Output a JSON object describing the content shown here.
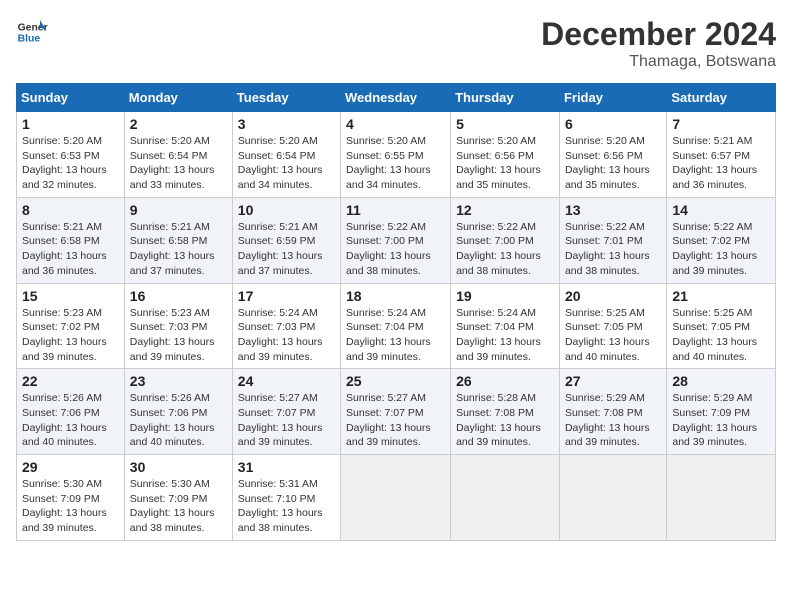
{
  "header": {
    "logo_line1": "General",
    "logo_line2": "Blue",
    "month": "December 2024",
    "location": "Thamaga, Botswana"
  },
  "weekdays": [
    "Sunday",
    "Monday",
    "Tuesday",
    "Wednesday",
    "Thursday",
    "Friday",
    "Saturday"
  ],
  "weeks": [
    [
      {
        "day": "1",
        "info": "Sunrise: 5:20 AM\nSunset: 6:53 PM\nDaylight: 13 hours\nand 32 minutes."
      },
      {
        "day": "2",
        "info": "Sunrise: 5:20 AM\nSunset: 6:54 PM\nDaylight: 13 hours\nand 33 minutes."
      },
      {
        "day": "3",
        "info": "Sunrise: 5:20 AM\nSunset: 6:54 PM\nDaylight: 13 hours\nand 34 minutes."
      },
      {
        "day": "4",
        "info": "Sunrise: 5:20 AM\nSunset: 6:55 PM\nDaylight: 13 hours\nand 34 minutes."
      },
      {
        "day": "5",
        "info": "Sunrise: 5:20 AM\nSunset: 6:56 PM\nDaylight: 13 hours\nand 35 minutes."
      },
      {
        "day": "6",
        "info": "Sunrise: 5:20 AM\nSunset: 6:56 PM\nDaylight: 13 hours\nand 35 minutes."
      },
      {
        "day": "7",
        "info": "Sunrise: 5:21 AM\nSunset: 6:57 PM\nDaylight: 13 hours\nand 36 minutes."
      }
    ],
    [
      {
        "day": "8",
        "info": "Sunrise: 5:21 AM\nSunset: 6:58 PM\nDaylight: 13 hours\nand 36 minutes."
      },
      {
        "day": "9",
        "info": "Sunrise: 5:21 AM\nSunset: 6:58 PM\nDaylight: 13 hours\nand 37 minutes."
      },
      {
        "day": "10",
        "info": "Sunrise: 5:21 AM\nSunset: 6:59 PM\nDaylight: 13 hours\nand 37 minutes."
      },
      {
        "day": "11",
        "info": "Sunrise: 5:22 AM\nSunset: 7:00 PM\nDaylight: 13 hours\nand 38 minutes."
      },
      {
        "day": "12",
        "info": "Sunrise: 5:22 AM\nSunset: 7:00 PM\nDaylight: 13 hours\nand 38 minutes."
      },
      {
        "day": "13",
        "info": "Sunrise: 5:22 AM\nSunset: 7:01 PM\nDaylight: 13 hours\nand 38 minutes."
      },
      {
        "day": "14",
        "info": "Sunrise: 5:22 AM\nSunset: 7:02 PM\nDaylight: 13 hours\nand 39 minutes."
      }
    ],
    [
      {
        "day": "15",
        "info": "Sunrise: 5:23 AM\nSunset: 7:02 PM\nDaylight: 13 hours\nand 39 minutes."
      },
      {
        "day": "16",
        "info": "Sunrise: 5:23 AM\nSunset: 7:03 PM\nDaylight: 13 hours\nand 39 minutes."
      },
      {
        "day": "17",
        "info": "Sunrise: 5:24 AM\nSunset: 7:03 PM\nDaylight: 13 hours\nand 39 minutes."
      },
      {
        "day": "18",
        "info": "Sunrise: 5:24 AM\nSunset: 7:04 PM\nDaylight: 13 hours\nand 39 minutes."
      },
      {
        "day": "19",
        "info": "Sunrise: 5:24 AM\nSunset: 7:04 PM\nDaylight: 13 hours\nand 39 minutes."
      },
      {
        "day": "20",
        "info": "Sunrise: 5:25 AM\nSunset: 7:05 PM\nDaylight: 13 hours\nand 40 minutes."
      },
      {
        "day": "21",
        "info": "Sunrise: 5:25 AM\nSunset: 7:05 PM\nDaylight: 13 hours\nand 40 minutes."
      }
    ],
    [
      {
        "day": "22",
        "info": "Sunrise: 5:26 AM\nSunset: 7:06 PM\nDaylight: 13 hours\nand 40 minutes."
      },
      {
        "day": "23",
        "info": "Sunrise: 5:26 AM\nSunset: 7:06 PM\nDaylight: 13 hours\nand 40 minutes."
      },
      {
        "day": "24",
        "info": "Sunrise: 5:27 AM\nSunset: 7:07 PM\nDaylight: 13 hours\nand 39 minutes."
      },
      {
        "day": "25",
        "info": "Sunrise: 5:27 AM\nSunset: 7:07 PM\nDaylight: 13 hours\nand 39 minutes."
      },
      {
        "day": "26",
        "info": "Sunrise: 5:28 AM\nSunset: 7:08 PM\nDaylight: 13 hours\nand 39 minutes."
      },
      {
        "day": "27",
        "info": "Sunrise: 5:29 AM\nSunset: 7:08 PM\nDaylight: 13 hours\nand 39 minutes."
      },
      {
        "day": "28",
        "info": "Sunrise: 5:29 AM\nSunset: 7:09 PM\nDaylight: 13 hours\nand 39 minutes."
      }
    ],
    [
      {
        "day": "29",
        "info": "Sunrise: 5:30 AM\nSunset: 7:09 PM\nDaylight: 13 hours\nand 39 minutes."
      },
      {
        "day": "30",
        "info": "Sunrise: 5:30 AM\nSunset: 7:09 PM\nDaylight: 13 hours\nand 38 minutes."
      },
      {
        "day": "31",
        "info": "Sunrise: 5:31 AM\nSunset: 7:10 PM\nDaylight: 13 hours\nand 38 minutes."
      },
      {
        "day": "",
        "info": ""
      },
      {
        "day": "",
        "info": ""
      },
      {
        "day": "",
        "info": ""
      },
      {
        "day": "",
        "info": ""
      }
    ]
  ]
}
